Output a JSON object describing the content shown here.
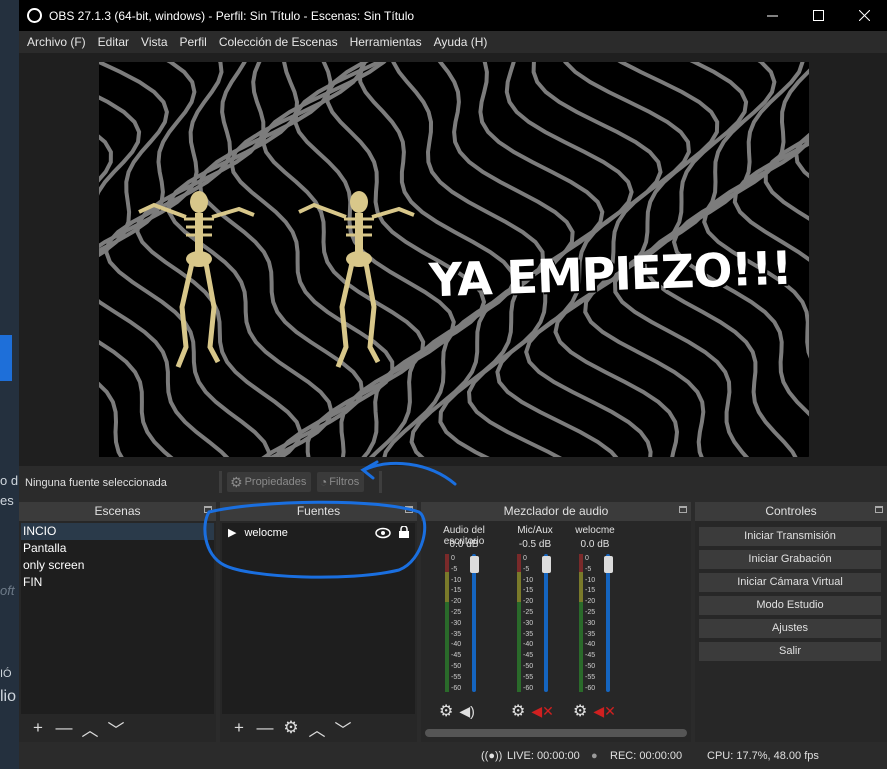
{
  "window": {
    "title": "OBS 27.1.3 (64-bit, windows) - Perfil: Sin Título - Escenas: Sin Título",
    "controls": [
      "minimize",
      "maximize",
      "close"
    ]
  },
  "background_fragments": [
    "o d",
    "es",
    "oft",
    "IÓ",
    "lio"
  ],
  "menu": [
    "Archivo (F)",
    "Editar",
    "Vista",
    "Perfil",
    "Colección de Escenas",
    "Herramientas",
    "Ayuda (H)"
  ],
  "preview": {
    "banner_text": "YA EMPIEZO!!!",
    "background_color": "#000000",
    "wave_color": "#8a8a8a"
  },
  "source_toolbar": {
    "no_selection": "Ninguna fuente seleccionada",
    "properties": "Propiedades",
    "filters": "Filtros"
  },
  "scenes": {
    "title": "Escenas",
    "items": [
      "INCIO",
      "Pantalla",
      "only screen",
      "FIN"
    ],
    "selected": "INCIO"
  },
  "sources": {
    "title": "Fuentes",
    "items": [
      {
        "name": "welocme",
        "visible": true,
        "locked": true
      }
    ]
  },
  "mixer": {
    "title": "Mezclador de audio",
    "channels": [
      {
        "name": "Audio del escritorio",
        "level": "0.0 dB",
        "muted": false
      },
      {
        "name": "Mic/Aux",
        "level": "-0.5 dB",
        "muted": true
      },
      {
        "name": "welocme",
        "level": "0.0 dB",
        "muted": true
      }
    ],
    "scale": [
      "0",
      "-5",
      "-10",
      "-15",
      "-20",
      "-25",
      "-30",
      "-35",
      "-40",
      "-45",
      "-50",
      "-55",
      "-60"
    ]
  },
  "controls": {
    "title": "Controles",
    "buttons": [
      "Iniciar Transmisión",
      "Iniciar Grabación",
      "Iniciar Cámara Virtual",
      "Modo Estudio",
      "Ajustes",
      "Salir"
    ]
  },
  "status": {
    "live": "LIVE: 00:00:00",
    "rec": "REC: 00:00:00",
    "cpu": "CPU: 17.7%, 48.00 fps"
  },
  "annotation_color": "#1a6fe0"
}
